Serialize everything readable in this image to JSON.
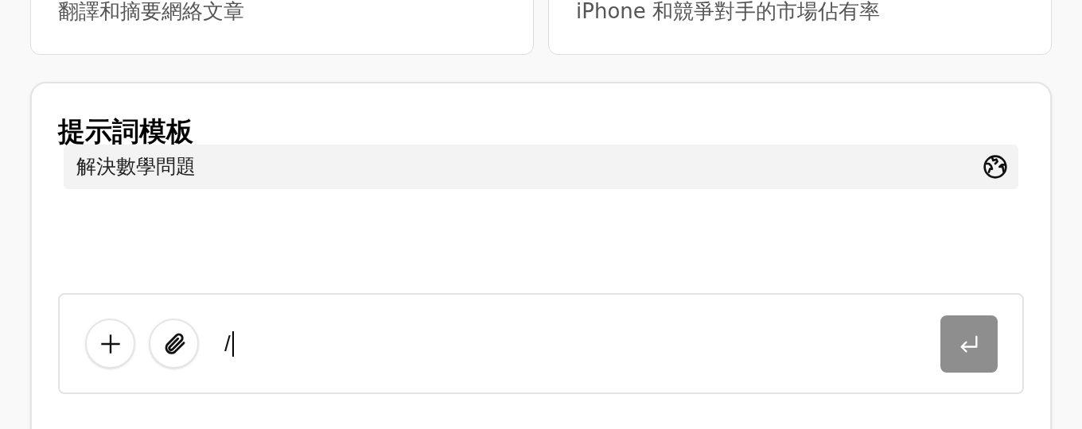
{
  "suggestions": [
    {
      "text": "翻譯和摘要網絡文章"
    },
    {
      "text": "iPhone 和競爭對手的市場佔有率"
    }
  ],
  "templates_panel": {
    "title": "提示詞模板",
    "templates": [
      {
        "label": "解決數學問題"
      }
    ]
  },
  "composer": {
    "value": "/"
  }
}
